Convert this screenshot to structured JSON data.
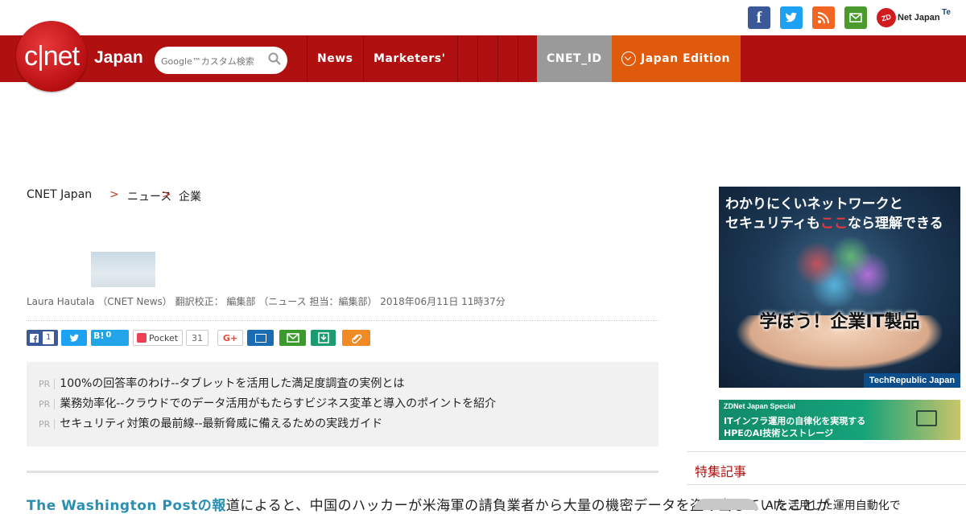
{
  "header": {
    "social": {
      "facebook": "f",
      "twitter": "t",
      "rss": "rss",
      "mail": "mail"
    },
    "zdnet_badge": "ZD",
    "zdnet_label": "Net Japan",
    "techrepublic_label": "Te"
  },
  "nav": {
    "logo_text": "c|net",
    "logo_suffix": "Japan",
    "search_placeholder": "Google™カスタム検索",
    "items": [
      "News",
      "Marketers'"
    ],
    "cnet_id": "CNET_ID",
    "edition": "Japan Edition"
  },
  "breadcrumb": {
    "home": "CNET Japan",
    "sep": ">",
    "level1": "ニュース",
    "level2": "企業"
  },
  "article": {
    "title": "",
    "byline": "Laura Hautala （CNET News） 翻訳校正： 編集部 （ニュース 担当：編集部）  2018年06月11日 11時37分",
    "share": {
      "facebook_count": "1",
      "hatena_label": "B!",
      "hatena_count": "0",
      "pocket_label": "Pocket",
      "pocket_count": "31",
      "gplus": "G+"
    },
    "pr_links": [
      {
        "tag": "PR",
        "text": "100%の回答率のわけ--タブレットを活用した満足度調査の実例とは"
      },
      {
        "tag": "PR",
        "text": "業務効率化--クラウドでのデータ活用がもたらすビジネス変革と導入のポイントを紹介"
      },
      {
        "tag": "PR",
        "text": "セキュリティ対策の最前線--最新脅威に備えるための実践ガイド"
      }
    ],
    "lead_link": "The Washington Post",
    "lead_link_suffix": "の報",
    "lead_rest": "道によると、中国のハッカーが米海軍の請負業者から大量の機密データを盗み出していたことが"
  },
  "sidebar": {
    "ad1": {
      "line1_pre": "わかりにくいネットワークと",
      "line2_pre": "セキュリティも",
      "line2_hl": "ここ",
      "line2_post": "なら理解できる",
      "center": "学ぼう！企業IT製品",
      "footer": "TechRepublic Japan"
    },
    "ad2": {
      "kicker": "ZDNet Japan Special",
      "line1": "ITインフラ運用の自律化を実現する",
      "line2": "HPEのAI技術とストレージ"
    },
    "section_title": "特集記事",
    "first_item": "AIを活用した運用自動化で"
  }
}
